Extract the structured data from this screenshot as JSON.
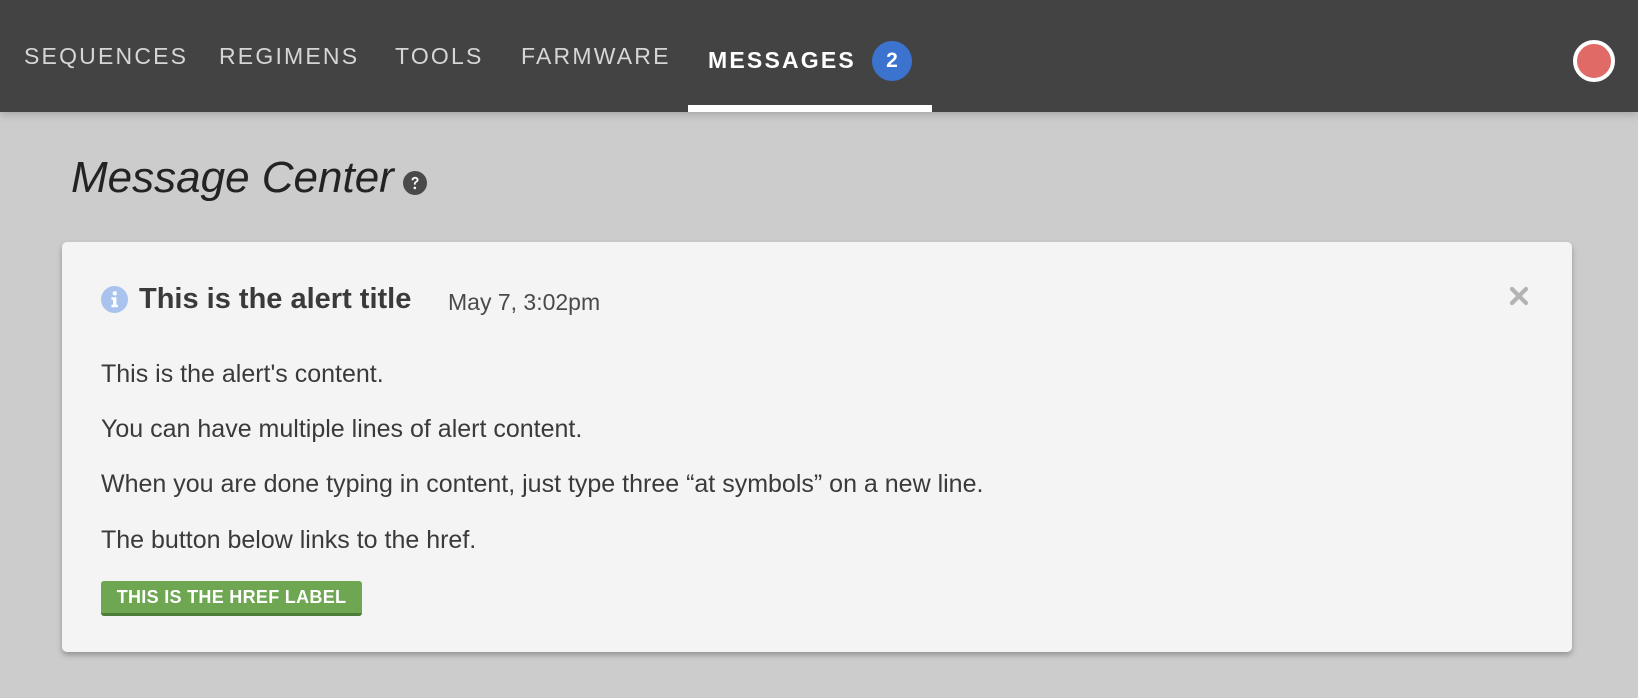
{
  "nav": {
    "items": [
      {
        "label": "SEQUENCES"
      },
      {
        "label": "REGIMENS"
      },
      {
        "label": "TOOLS"
      },
      {
        "label": "FARMWARE"
      },
      {
        "label": "MESSAGES",
        "active": true
      }
    ],
    "messages_badge": "2",
    "status_color": "#e06a66",
    "badge_color": "#3b73cf"
  },
  "page": {
    "title": "Message Center",
    "help_icon": "question-circle-icon"
  },
  "alert": {
    "icon": "info-circle-icon",
    "title": "This is the alert title",
    "timestamp": "May 7, 3:02pm",
    "content_lines": [
      "This is the alert's content.",
      "You can have multiple lines of alert content.",
      "When you are done typing in content, just type three “at symbols” on a new line.",
      "The button below links to the href."
    ],
    "button_label": "THIS IS THE HREF LABEL",
    "button_color": "#6ea652",
    "close_icon": "close-icon"
  }
}
